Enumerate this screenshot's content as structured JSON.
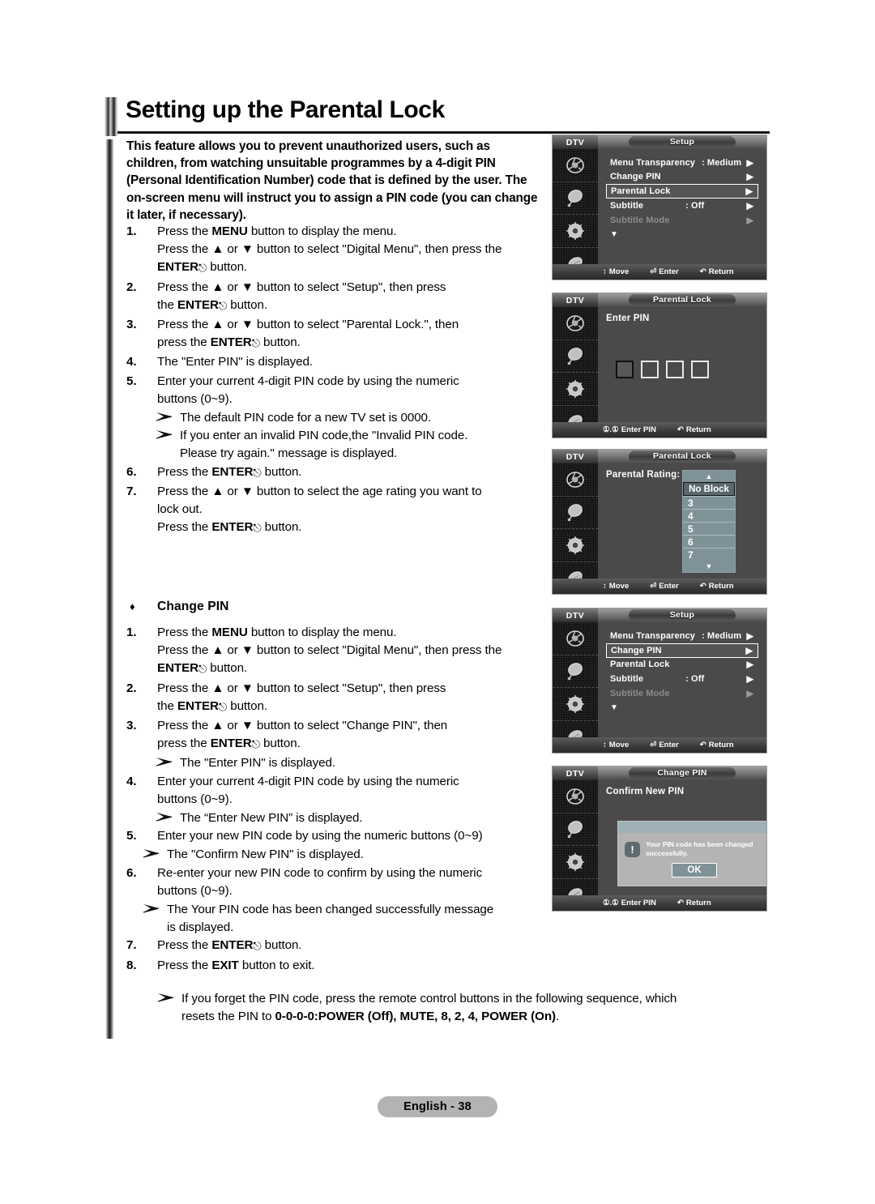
{
  "page": {
    "title": "Setting up the Parental Lock",
    "footer": "English - 38",
    "intro": "This feature allows you to prevent unauthorized users, such as children, from watching unsuitable programmes by a 4-digit PIN (Personal Identification Number) code that is defined by the user.  The on-screen menu will instruct you to assign a PIN code (you can change it later, if necessary)."
  },
  "parental_lock_steps": [
    {
      "num": "1.",
      "lines": [
        "Press the MENU button to display the menu.",
        "Press the ▲ or ▼ button to select \"Digital Menu\", then press the",
        "ENTER↵ button."
      ]
    },
    {
      "num": "2.",
      "lines": [
        "Press the ▲ or ▼ button to select \"Setup\", then press",
        "the ENTER↵ button."
      ]
    },
    {
      "num": "3.",
      "lines": [
        "Press the ▲ or ▼ button to select \"Parental Lock.\", then",
        "press the ENTER↵ button."
      ]
    },
    {
      "num": "4.",
      "lines": [
        "The \"Enter PIN\" is displayed."
      ]
    },
    {
      "num": "5.",
      "lines": [
        "Enter your current 4-digit PIN code by using the numeric",
        "buttons (0~9)."
      ]
    },
    {
      "num": "6.",
      "lines": [
        "Press the ENTER↵ button."
      ]
    },
    {
      "num": "7.",
      "lines": [
        "Press the ▲ or ▼ button to select the age rating you want to",
        "lock out.",
        "Press the ENTER↵ button."
      ]
    }
  ],
  "parental_lock_notes": {
    "default_pin": "The default PIN code for a new TV set is 0000.",
    "invalid_pin_l1": "If you enter an invalid PIN code,the \"Invalid PIN code.",
    "invalid_pin_l2": "Please try again.\" message is displayed."
  },
  "change_pin": {
    "heading": "Change PIN",
    "bullet": "♦",
    "steps": [
      {
        "num": "1.",
        "lines": [
          "Press the MENU button to display the menu.",
          "Press the ▲ or ▼ button to select \"Digital Menu\", then press the",
          "ENTER↵ button."
        ]
      },
      {
        "num": "2.",
        "lines": [
          "Press the ▲ or ▼ button to select \"Setup\", then press",
          "the ENTER↵ button."
        ]
      },
      {
        "num": "3.",
        "lines": [
          "Press the ▲ or ▼ button to select \"Change PIN\", then",
          "press the ENTER↵ button."
        ]
      },
      {
        "num": "4.",
        "lines": [
          "Enter your current 4-digit PIN code by using the numeric",
          "buttons (0~9)."
        ]
      },
      {
        "num": "5.",
        "lines": [
          "Enter your new PIN code by using the numeric buttons (0~9)"
        ]
      },
      {
        "num": "6.",
        "lines": [
          "Re-enter your new PIN code to confirm by using the numeric",
          "buttons (0~9)."
        ]
      },
      {
        "num": "7.",
        "lines": [
          "Press the ENTER↵ button."
        ]
      },
      {
        "num": "8.",
        "lines": [
          "Press the EXIT button to exit."
        ]
      }
    ],
    "notes": {
      "enter_pin": "The \"Enter PIN\" is displayed.",
      "enter_new_pin": "The “Enter New PIN” is displayed.",
      "confirm_new_pin": "The \"Confirm New PIN\" is displayed.",
      "changed_l1": "The Your PIN code has been changed successfully message",
      "changed_l2": "is displayed.",
      "forgot_l1": "If you forget the PIN code, press the remote control buttons in the following sequence, which",
      "forgot_l2_pre": "resets the PIN to ",
      "forgot_l2_bold": "0-0-0-0:POWER (Off), MUTE, 8, 2, 4, POWER (On)",
      "forgot_l2_post": "."
    }
  },
  "osd_panels": [
    {
      "id": "setup-parental-lock",
      "source": "DTV",
      "title": "Setup",
      "rows": [
        {
          "label": "Menu Transparency",
          "value": ": Medium",
          "arrow": "▶",
          "state": "normal"
        },
        {
          "label": "Change PIN",
          "value": "",
          "arrow": "▶",
          "state": "normal"
        },
        {
          "label": "Parental Lock",
          "value": "",
          "arrow": "▶",
          "state": "selected"
        },
        {
          "label": "Subtitle",
          "value": ": Off",
          "arrow": "▶",
          "state": "normal"
        },
        {
          "label": "Subtitle  Mode",
          "value": "",
          "arrow": "▶",
          "state": "dim"
        }
      ],
      "more_glyph": "▼",
      "footer": [
        {
          "glyph": "↕",
          "label": "Move"
        },
        {
          "glyph": "⏎",
          "label": "Enter"
        },
        {
          "glyph": "↶",
          "label": "Return"
        }
      ]
    },
    {
      "id": "parental-lock-enter-pin",
      "source": "DTV",
      "title": "Parental Lock",
      "label": "Enter PIN",
      "pin_boxes": 4,
      "pin_active_index": 0,
      "footer": [
        {
          "glyph": "①.①",
          "label": "Enter PIN"
        },
        {
          "glyph": "↶",
          "label": "Return"
        }
      ]
    },
    {
      "id": "parental-lock-rating",
      "source": "DTV",
      "title": "Parental Lock",
      "label": "Parental Rating:",
      "rating_up": "▲",
      "rating_down": "▼",
      "rating_options": [
        "No Block",
        "3",
        "4",
        "5",
        "6",
        "7"
      ],
      "rating_selected": "No Block",
      "footer": [
        {
          "glyph": "↕",
          "label": "Move"
        },
        {
          "glyph": "⏎",
          "label": "Enter"
        },
        {
          "glyph": "↶",
          "label": "Return"
        }
      ]
    },
    {
      "id": "setup-change-pin",
      "source": "DTV",
      "title": "Setup",
      "rows": [
        {
          "label": "Menu Transparency",
          "value": ": Medium",
          "arrow": "▶",
          "state": "normal"
        },
        {
          "label": "Change PIN",
          "value": "",
          "arrow": "▶",
          "state": "selected"
        },
        {
          "label": "Parental Lock",
          "value": "",
          "arrow": "▶",
          "state": "normal"
        },
        {
          "label": "Subtitle",
          "value": ": Off",
          "arrow": "▶",
          "state": "normal"
        },
        {
          "label": "Subtitle  Mode",
          "value": "",
          "arrow": "▶",
          "state": "dim"
        }
      ],
      "more_glyph": "▼",
      "footer": [
        {
          "glyph": "↕",
          "label": "Move"
        },
        {
          "glyph": "⏎",
          "label": "Enter"
        },
        {
          "glyph": "↶",
          "label": "Return"
        }
      ]
    },
    {
      "id": "change-pin-confirm",
      "source": "DTV",
      "title": "Change PIN",
      "label": "Confirm New PIN",
      "dialog": {
        "icon": "!",
        "message": "Your PIN code has been changed successfully.",
        "ok": "OK"
      },
      "footer": [
        {
          "glyph": "①.①",
          "label": "Enter PIN"
        },
        {
          "glyph": "↶",
          "label": "Return"
        }
      ]
    }
  ],
  "colors": {
    "osd_body": "#4a4a4a",
    "osd_sidebar": "#141414",
    "rating_list": "#7f9297",
    "dialog_header": "#9eb0b5",
    "dialog_body": "#b4b4b4",
    "footer_badge": "#b3b3b3"
  }
}
